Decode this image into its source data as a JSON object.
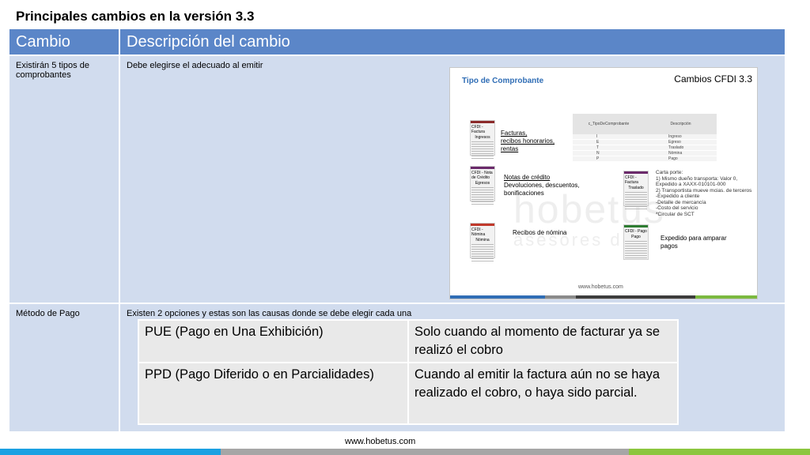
{
  "title": "Principales cambios en la versión 3.3",
  "table": {
    "headers": [
      "Cambio",
      "Descripción del cambio"
    ],
    "rows": [
      {
        "cambio": "Existirán 5 tipos de comprobantes",
        "descripcion": "Debe elegirse el adecuado al emitir"
      },
      {
        "cambio": "Método de Pago",
        "descripcion": "Existen 2 opciones y estas son las causas donde se debe elegir cada una"
      }
    ]
  },
  "embedded": {
    "heading": "Tipo de Comprobante",
    "title": "Cambios CFDI 3.3",
    "watermark_main": "hobetus",
    "watermark_sub": "asesores de",
    "catalog_headers": [
      "c_TipoDeComprobante",
      "Descripción"
    ],
    "catalog_rows": [
      {
        "code": "I",
        "desc": "Ingreso"
      },
      {
        "code": "E",
        "desc": "Egreso"
      },
      {
        "code": "T",
        "desc": "Traslado"
      },
      {
        "code": "N",
        "desc": "Nómina"
      },
      {
        "code": "P",
        "desc": "Pago"
      }
    ],
    "docs": [
      {
        "header": "CFDI - Factura",
        "name": "Ingresos",
        "color": "#8b2a2a"
      },
      {
        "header": "CFDI - Nota de Crédito",
        "name": "Egresos",
        "color": "#6b2a6b"
      },
      {
        "header": "CFDI - Factura",
        "name": "Traslado",
        "color": "#6b2a6b"
      },
      {
        "header": "CFDI - Nómina",
        "name": "Nómina",
        "color": "#c0392b"
      },
      {
        "header": "CFDI - Pago",
        "name": "Pago",
        "color": "#2e7d32"
      }
    ],
    "note_ingresos": [
      "Facturas,",
      "recibos honorarios,",
      "rentas"
    ],
    "note_egresos_title": "Notas de crédito",
    "note_egresos_rest": [
      "Devoluciones, descuentos,",
      "bonificaciones"
    ],
    "note_nomina": "Recibos de nómina",
    "note_pago": [
      "Expedido para amparar",
      "pagos"
    ],
    "note_traslado": [
      "Carta porte:",
      "1)  Mismo dueño transporta: Valor 0,",
      "Expedido a XAXX-010101-000",
      "2) Transportista mueve mcias. de terceros",
      "-Expedido a cliente",
      "-Detalle de mercancía",
      "-Costo del servicio",
      "*Circular de SCT"
    ],
    "site": "www.hobetus.com",
    "bar_colors": [
      "#2f6db5",
      "#8a8a8a",
      "#3c3c3c",
      "#7bb93f"
    ]
  },
  "metodo_pago": [
    {
      "opcion": "PUE (Pago en Una Exhibición)",
      "descripcion": "Solo cuando al momento de facturar ya se realizó el cobro"
    },
    {
      "opcion": "PPD (Pago Diferido o en Parcialidades)",
      "descripcion": "Cuando al emitir la factura aún no se haya realizado el cobro, o haya sido parcial."
    }
  ],
  "footer": {
    "url": "www.hobetus.com",
    "bar_colors": [
      "#1ba1e2",
      "#a6a6a6",
      "#8cc63f"
    ]
  }
}
